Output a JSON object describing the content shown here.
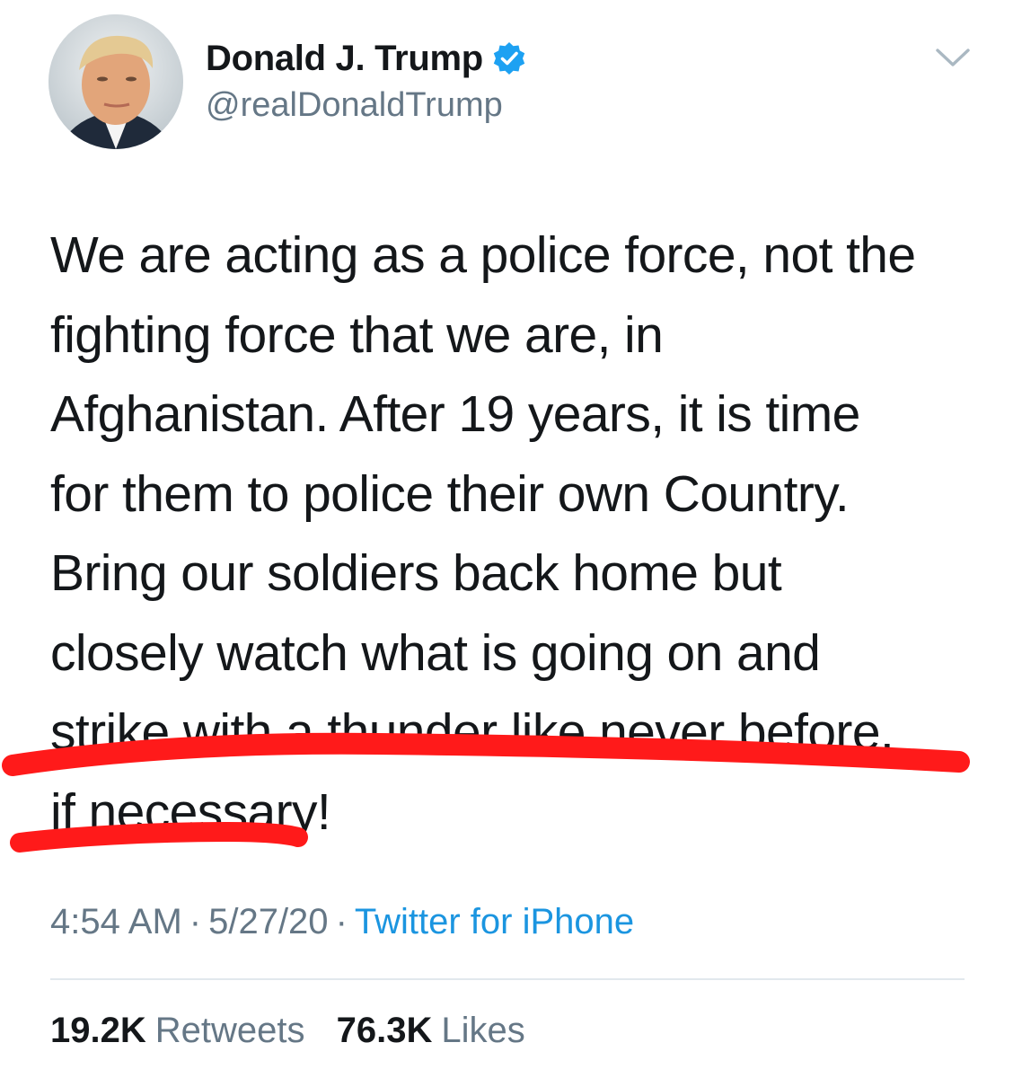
{
  "author": {
    "display_name": "Donald J. Trump",
    "handle": "@realDonaldTrump",
    "verified": true,
    "avatar_icon": "profile-photo"
  },
  "menu_icon": "chevron-down-icon",
  "tweet": {
    "lines": [
      "We are acting as a police force, not the",
      "fighting force that we are, in",
      "Afghanistan. After 19 years, it is time",
      "for them to police their own Country.",
      "Bring our soldiers back home but",
      "closely watch what is going on and",
      "strike with a thunder like never before,",
      "if necessary!"
    ]
  },
  "annotation": {
    "color": "#ff1a1a",
    "description_icon": "red-underline-mark"
  },
  "meta": {
    "time": "4:54 AM",
    "separator": "·",
    "date": "5/27/20",
    "source": "Twitter for iPhone"
  },
  "stats": {
    "retweets_count": "19.2K",
    "retweets_label": "Retweets",
    "likes_count": "76.3K",
    "likes_label": "Likes"
  },
  "colors": {
    "text": "#14171a",
    "secondary": "#657786",
    "link": "#1b95e0",
    "verified": "#1da1f2",
    "divider": "#e1e8ed"
  }
}
